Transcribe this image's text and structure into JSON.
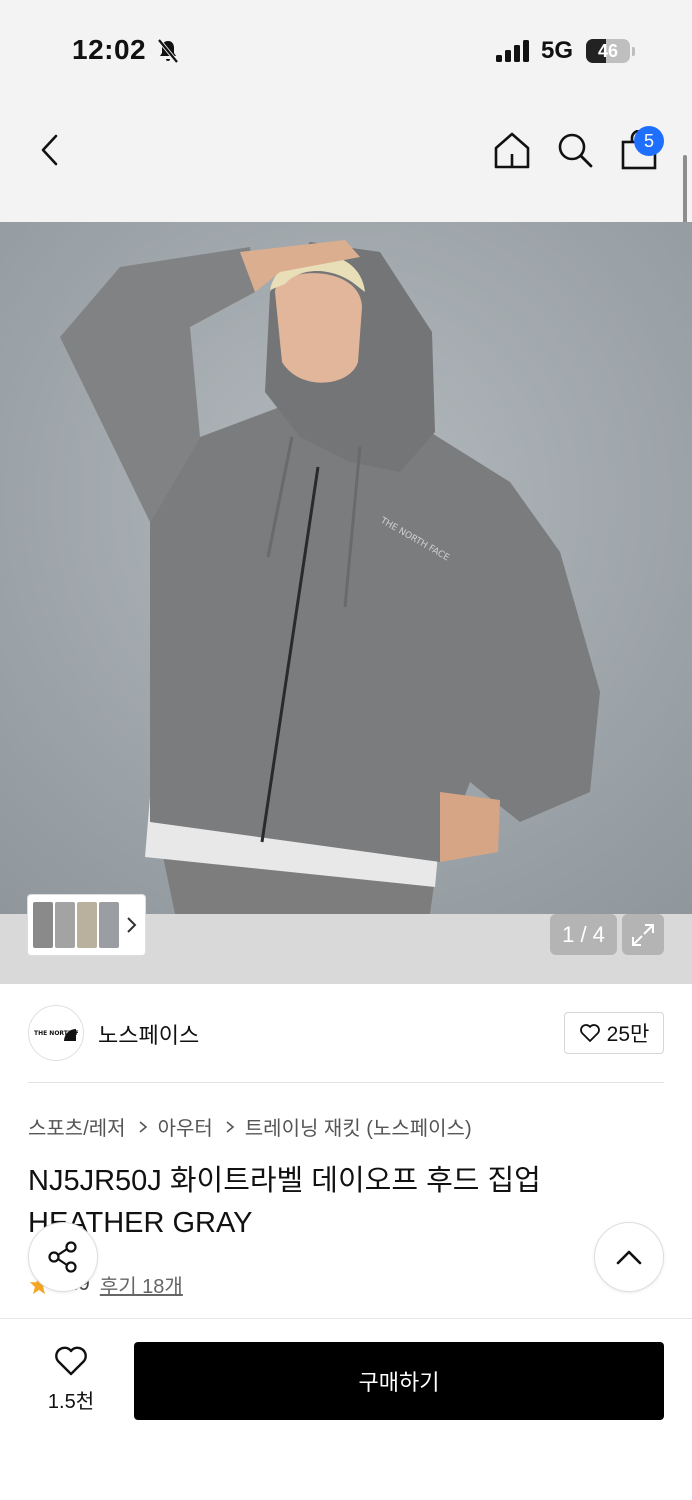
{
  "status_bar": {
    "time": "12:02",
    "network": "5G",
    "battery": "46",
    "battery_fraction": 0.46
  },
  "header": {
    "cart_count": "5"
  },
  "gallery": {
    "counter": "1 / 4"
  },
  "brand": {
    "logo_text": "THE NORTH FACE",
    "name": "노스페이스",
    "likes": "25만"
  },
  "breadcrumb": [
    "스포츠/레저",
    "아우터",
    "트레이닝 재킷 (노스페이스)"
  ],
  "product": {
    "title": "NJ5JR50J 화이트라벨 데이오프 후드 집업 HEATHER GRAY",
    "rating": "4.9",
    "reviews": "후기 18개",
    "print_logo": "THE NORTH FACE"
  },
  "bottom": {
    "wish_count": "1.5천",
    "buy_label": "구매하기"
  },
  "colors": {
    "accent_badge": "#1f6fff",
    "buy_button": "#000000",
    "star": "#f5a623"
  }
}
